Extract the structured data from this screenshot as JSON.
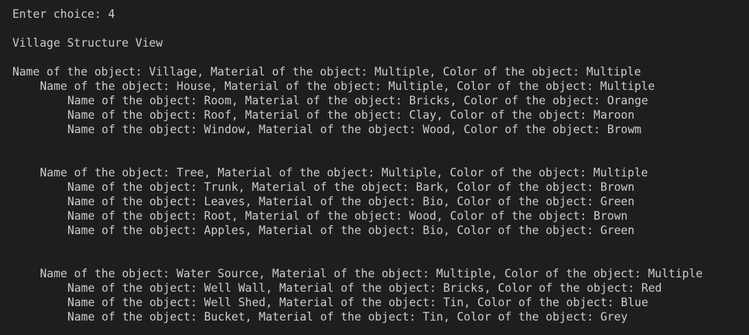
{
  "prompt_line": "Enter choice: 4",
  "heading": "Village Structure View",
  "lines": [
    "Name of the object: Village, Material of the object: Multiple, Color of the object: Multiple",
    "Name of the object: House, Material of the object: Multiple, Color of the object: Multiple",
    "Name of the object: Room, Material of the object: Bricks, Color of the object: Orange",
    "Name of the object: Roof, Material of the object: Clay, Color of the object: Maroon",
    "Name of the object: Window, Material of the object: Wood, Color of the object: Browm",
    "Name of the object: Tree, Material of the object: Multiple, Color of the object: Multiple",
    "Name of the object: Trunk, Material of the object: Bark, Color of the object: Brown",
    "Name of the object: Leaves, Material of the object: Bio, Color of the object: Green",
    "Name of the object: Root, Material of the object: Wood, Color of the object: Brown",
    "Name of the object: Apples, Material of the object: Bio, Color of the object: Green",
    "Name of the object: Water Source, Material of the object: Multiple, Color of the object: Multiple",
    "Name of the object: Well Wall, Material of the object: Bricks, Color of the object: Red",
    "Name of the object: Well Shed, Material of the object: Tin, Color of the object: Blue",
    "Name of the object: Bucket, Material of the object: Tin, Color of the object: Grey"
  ],
  "colors": {
    "background": "#1e1e1e",
    "text": "#cccccc"
  }
}
